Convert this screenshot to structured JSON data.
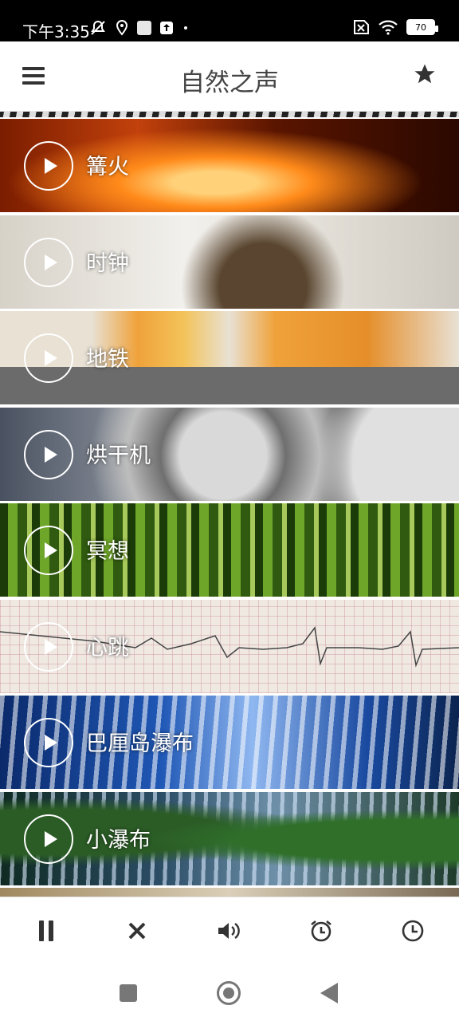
{
  "status_bar": {
    "time": "下午3:35",
    "battery": "70"
  },
  "header": {
    "title": "自然之声",
    "menu_icon": "hamburger-menu-icon",
    "favorite_icon": "star-icon"
  },
  "sounds": [
    {
      "label": "篝火"
    },
    {
      "label": "时钟"
    },
    {
      "label": "地铁"
    },
    {
      "label": "烘干机"
    },
    {
      "label": "冥想"
    },
    {
      "label": "心跳"
    },
    {
      "label": "巴厘岛瀑布"
    },
    {
      "label": "小瀑布"
    }
  ],
  "controls": {
    "pause_icon": "pause-icon",
    "close_icon": "close-icon",
    "volume_icon": "volume-icon",
    "alarm_icon": "alarm-clock-icon",
    "timer_icon": "timer-clock-icon"
  },
  "colors": {
    "title_text": "#444444",
    "icon": "#333333"
  }
}
